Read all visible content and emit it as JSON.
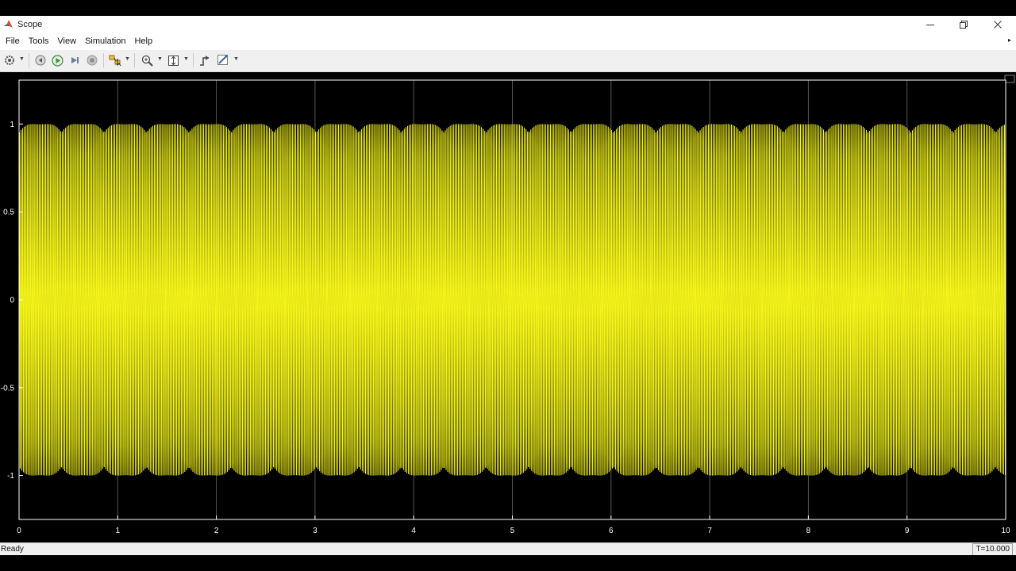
{
  "window": {
    "title": "Scope",
    "minimize_icon": "minimize-icon",
    "restore_icon": "restore-icon",
    "close_icon": "close-icon"
  },
  "menu": {
    "items": [
      "File",
      "Tools",
      "View",
      "Simulation",
      "Help"
    ]
  },
  "toolbar": {
    "icons": [
      "configuration-gear-icon",
      "step-back-icon",
      "run-icon",
      "step-forward-icon",
      "stop-icon",
      "highlight-simulink-block-icon",
      "zoom-icon",
      "scale-axes-icon",
      "triggers-icon",
      "measurements-icon"
    ]
  },
  "status": {
    "text": "Ready",
    "time": "T=10.000"
  },
  "colors": {
    "signal": "#f5f51a",
    "plot_background": "#000000",
    "axes_color": "#ffffff",
    "grid_color": "#555555"
  },
  "chart_data": {
    "type": "line",
    "title": "",
    "xlabel": "",
    "ylabel": "",
    "xlim": [
      0,
      10
    ],
    "ylim": [
      -1.25,
      1.25
    ],
    "xticks": [
      "0",
      "1",
      "2",
      "3",
      "4",
      "5",
      "6",
      "7",
      "8",
      "9",
      "10"
    ],
    "yticks": [
      "1",
      "0.5",
      "0",
      "-0.5",
      "-1"
    ],
    "ytick_values": [
      1,
      0.5,
      0,
      -0.5,
      -1
    ],
    "grid": true,
    "series": [
      {
        "color": "#f5f51a",
        "description": "dense high-frequency sinusoid",
        "amplitude": 1,
        "frequency_hz": 60,
        "x_range": [
          0,
          10
        ]
      }
    ]
  }
}
